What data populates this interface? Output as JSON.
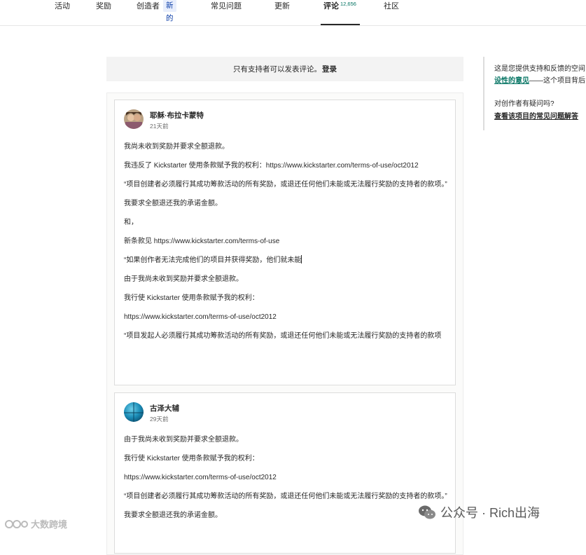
{
  "nav": {
    "tabs": [
      {
        "label": "活动"
      },
      {
        "label": "奖励"
      },
      {
        "label": "创造者",
        "badge": "新的"
      },
      {
        "label": "常见问题"
      },
      {
        "label": "更新"
      },
      {
        "label": "评论",
        "count": "12,656",
        "active": true
      },
      {
        "label": "社区"
      }
    ]
  },
  "banner": {
    "text": "只有支持者可以发表评论。",
    "login": "登录"
  },
  "sidebar": {
    "line1": "这是您提供支持和反馈的空间",
    "line2_link": "设性的意见",
    "line2_rest": "——这个项目背后",
    "question": "对创作者有疑问吗?",
    "faq_link": "查看该项目的常见问题解答"
  },
  "comments": [
    {
      "author": "耶稣·布拉卡蒙特",
      "time": "21天前",
      "paragraphs": [
        "我尚未收到奖励并要求全额退款。",
        "我违反了 Kickstarter 使用条款赋予我的权利：https://www.kickstarter.com/terms-of-use/oct2012",
        "“项目创建者必须履行其成功筹款活动的所有奖励，或退还任何他们未能或无法履行奖励的支持者的款项。”",
        "我要求全额退还我的承诺金额。",
        "和，",
        "新条款见 https://www.kickstarter.com/terms-of-use",
        "“如果创作者无法完成他们的项目并获得奖励，他们就未能",
        "由于我尚未收到奖励并要求全额退款。",
        "我行使 Kickstarter 使用条款赋予我的权利：",
        "https://www.kickstarter.com/terms-of-use/oct2012",
        "“项目发起人必须履行其成功筹款活动的所有奖励，或退还任何他们未能或无法履行奖励的支持者的款项"
      ]
    },
    {
      "author": "古泽大辅",
      "time": "29天前",
      "paragraphs": [
        "由于我尚未收到奖励并要求全额退款。",
        "我行使 Kickstarter 使用条款赋予我的权利：",
        "https://www.kickstarter.com/terms-of-use/oct2012",
        "“项目创建者必须履行其成功筹款活动的所有奖励，或退还任何他们未能或无法履行奖励的支持者的款项。”",
        "我要求全额退还我的承诺金额。"
      ]
    }
  ],
  "watermarks": {
    "left": "大数跨境",
    "right": "公众号 · Rich出海"
  },
  "colors": {
    "accent_green": "#037362",
    "badge_bg": "#e8eefc",
    "badge_text": "#0b3ea8",
    "banner_bg": "#f3f3f3"
  }
}
